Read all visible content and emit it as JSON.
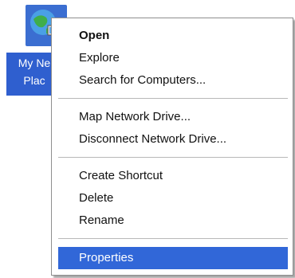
{
  "desktop_icon": {
    "icon": "network-places-icon",
    "label_line1": "My Ne",
    "label_line2": "Plac"
  },
  "context_menu": {
    "items": [
      {
        "label": "Open",
        "bold": true
      },
      {
        "label": "Explore"
      },
      {
        "label": "Search for Computers..."
      },
      {
        "label": "Map Network Drive..."
      },
      {
        "label": "Disconnect Network Drive..."
      },
      {
        "label": "Create Shortcut"
      },
      {
        "label": "Delete"
      },
      {
        "label": "Rename"
      },
      {
        "label": "Properties",
        "selected": true
      }
    ]
  },
  "colors": {
    "selection": "#3167d8",
    "icon_label_bg": "#2f5fcf"
  }
}
